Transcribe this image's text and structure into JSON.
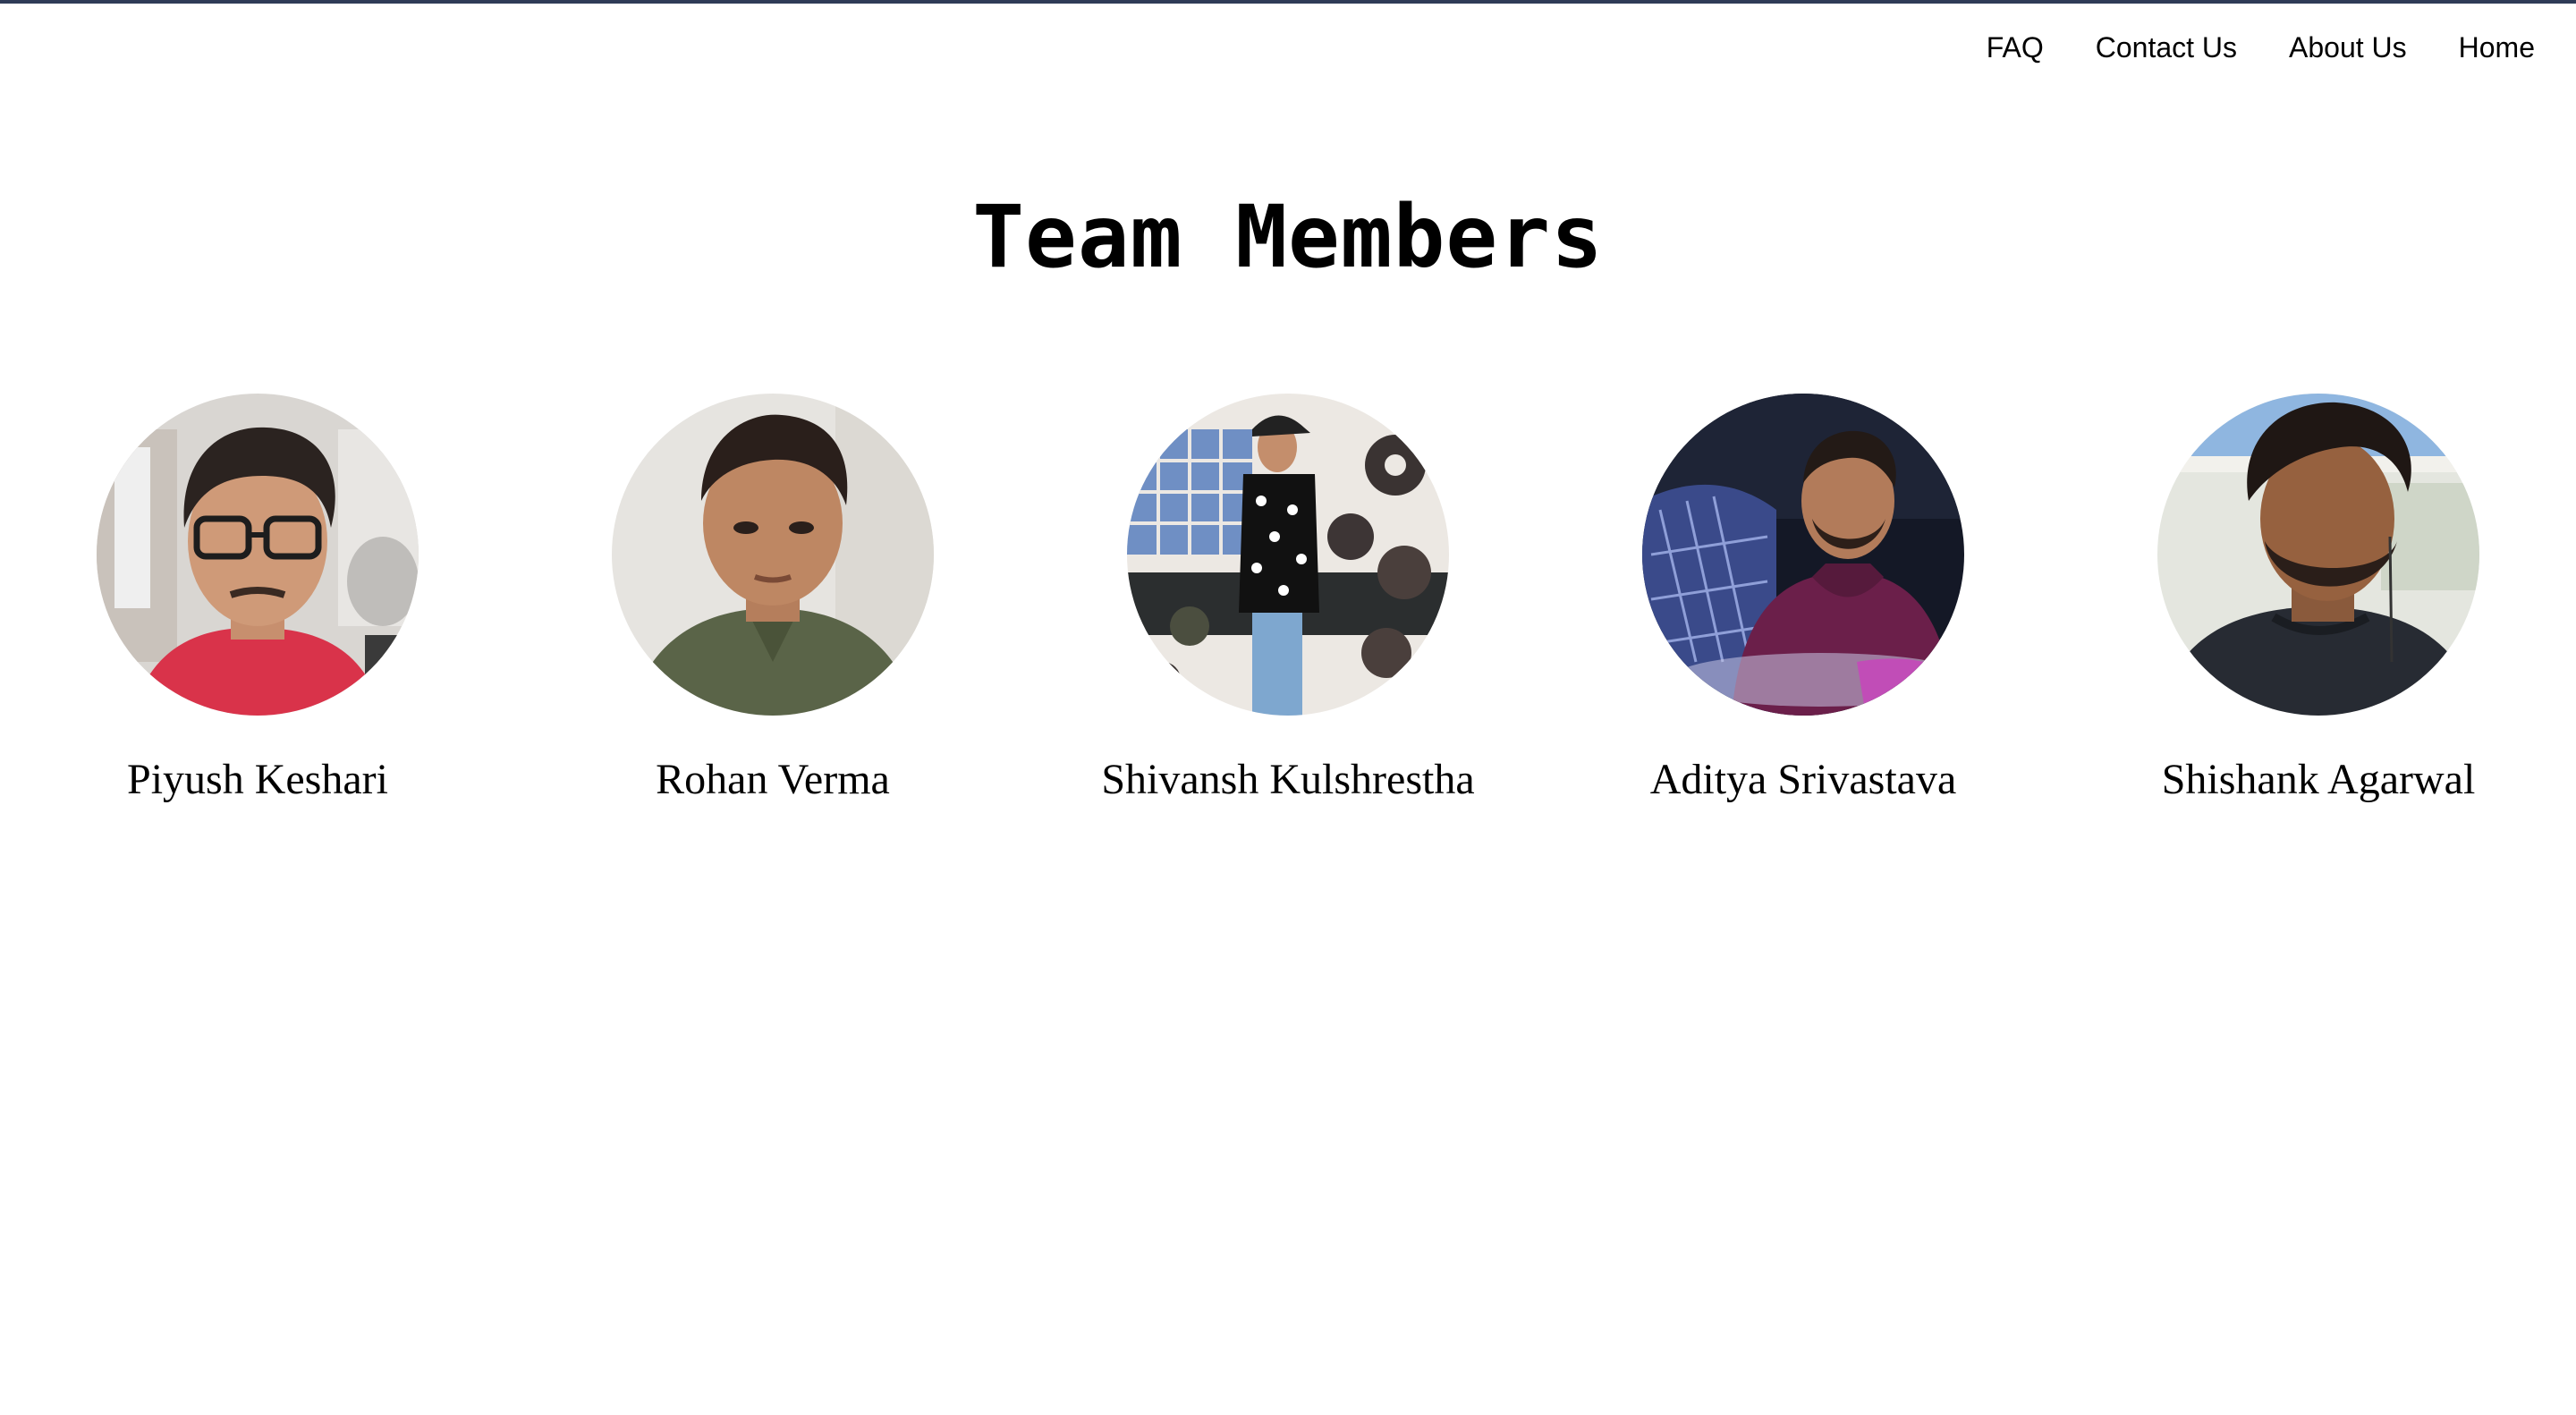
{
  "nav": {
    "items": [
      {
        "label": "FAQ"
      },
      {
        "label": "Contact Us"
      },
      {
        "label": "About Us"
      },
      {
        "label": "Home"
      }
    ]
  },
  "page": {
    "title": "Team Members"
  },
  "team": {
    "members": [
      {
        "name": "Piyush Keshari"
      },
      {
        "name": "Rohan Verma"
      },
      {
        "name": "Shivansh Kulshrestha"
      },
      {
        "name": "Aditya Srivastava"
      },
      {
        "name": "Shishank Agarwal"
      }
    ]
  },
  "colors": {
    "top_rule": "#2f3b57",
    "text": "#000000",
    "background": "#ffffff"
  }
}
